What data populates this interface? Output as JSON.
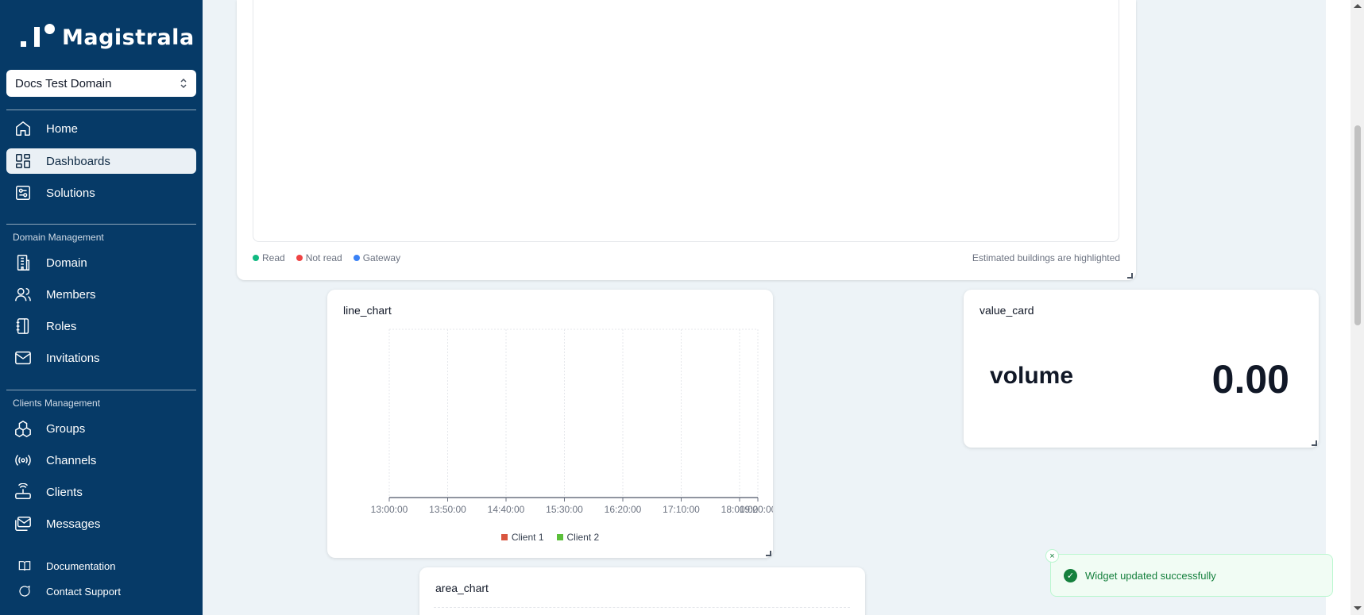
{
  "app": {
    "name": "Magistrala"
  },
  "domain_select": {
    "value": "Docs Test Domain"
  },
  "nav": {
    "primary": [
      {
        "label": "Home",
        "icon": "home-icon"
      },
      {
        "label": "Dashboards",
        "icon": "dashboard-icon",
        "active": true
      },
      {
        "label": "Solutions",
        "icon": "solutions-icon"
      }
    ],
    "domain_management": {
      "title": "Domain Management",
      "items": [
        {
          "label": "Domain",
          "icon": "building-icon"
        },
        {
          "label": "Members",
          "icon": "users-icon"
        },
        {
          "label": "Roles",
          "icon": "roles-icon"
        },
        {
          "label": "Invitations",
          "icon": "mail-icon"
        }
      ]
    },
    "clients_management": {
      "title": "Clients Management",
      "items": [
        {
          "label": "Groups",
          "icon": "groups-icon"
        },
        {
          "label": "Channels",
          "icon": "broadcast-icon"
        },
        {
          "label": "Clients",
          "icon": "router-icon"
        },
        {
          "label": "Messages",
          "icon": "messages-icon"
        }
      ]
    },
    "footer": [
      {
        "label": "Documentation",
        "icon": "book-icon"
      },
      {
        "label": "Contact Support",
        "icon": "chat-icon"
      }
    ]
  },
  "map_widget": {
    "legend": [
      {
        "label": "Read",
        "color": "#10b981"
      },
      {
        "label": "Not read",
        "color": "#ef4444"
      },
      {
        "label": "Gateway",
        "color": "#3b82f6"
      }
    ],
    "note": "Estimated buildings are highlighted"
  },
  "line_widget": {
    "title": "line_chart",
    "chart_data": {
      "type": "line",
      "x_ticks": [
        "13:00:00",
        "13:50:00",
        "14:40:00",
        "15:30:00",
        "16:20:00",
        "17:10:00",
        "18:00:00",
        "19:20:00"
      ],
      "series": [
        {
          "name": "Client 1",
          "color": "#d9553f",
          "values": []
        },
        {
          "name": "Client 2",
          "color": "#5bbf3a",
          "values": []
        }
      ]
    }
  },
  "value_widget": {
    "title": "value_card",
    "label": "volume",
    "value": "0.00"
  },
  "area_widget": {
    "title": "area_chart"
  },
  "toast": {
    "message": "Widget updated successfully",
    "close": "×",
    "check": "✓"
  }
}
